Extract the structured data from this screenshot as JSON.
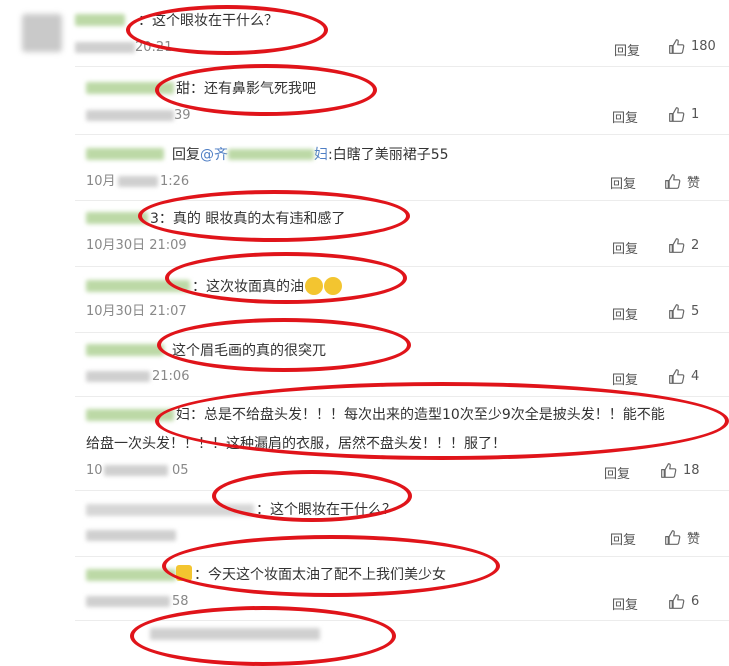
{
  "comments": [
    {
      "text": "：这个眼妆在干什么？",
      "date": "20:21",
      "reply": "回复",
      "likes": "180"
    },
    {
      "text": "甜：还有鼻影气死我吧",
      "date": "39",
      "reply": "回复",
      "likes": "1"
    },
    {
      "reply_prefix": "回复",
      "mention": "@齐",
      "mention_end": "妇",
      "text": ":白瞎了美丽裙子55",
      "date": "10月",
      "time": "1:26",
      "reply": "回复",
      "likes": "赞"
    },
    {
      "text": "3：真的 眼妆真的太有违和感了",
      "date": "10月30日 21:09",
      "reply": "回复",
      "likes": "2"
    },
    {
      "text": "：这次妆面真的油",
      "date": "10月30日 21:07",
      "reply": "回复",
      "likes": "5"
    },
    {
      "text": "这个眉毛画的真的很突兀",
      "date": "21:06",
      "reply": "回复",
      "likes": "4"
    },
    {
      "text_line1": "妇：总是不给盘头发！！！每次出来的造型10次至少9次全是披头发！！能不能",
      "text_line2": "给盘一次头发！！！！这种漏肩的衣服，居然不盘头发！！！服了！",
      "date": "10",
      "time": "05",
      "reply": "回复",
      "likes": "18"
    },
    {
      "text": "：这个眼妆在干什么？",
      "reply": "回复",
      "likes": "赞"
    },
    {
      "text": "：今天这个妆面太油了配不上我们美少女",
      "date": "58",
      "reply": "回复",
      "likes": "6"
    }
  ],
  "colors": {
    "ring": "#e0141a",
    "link": "#4e7ec4"
  },
  "icons": {
    "like": "thumbs-up-icon",
    "emoji": "grinning-emoji"
  }
}
